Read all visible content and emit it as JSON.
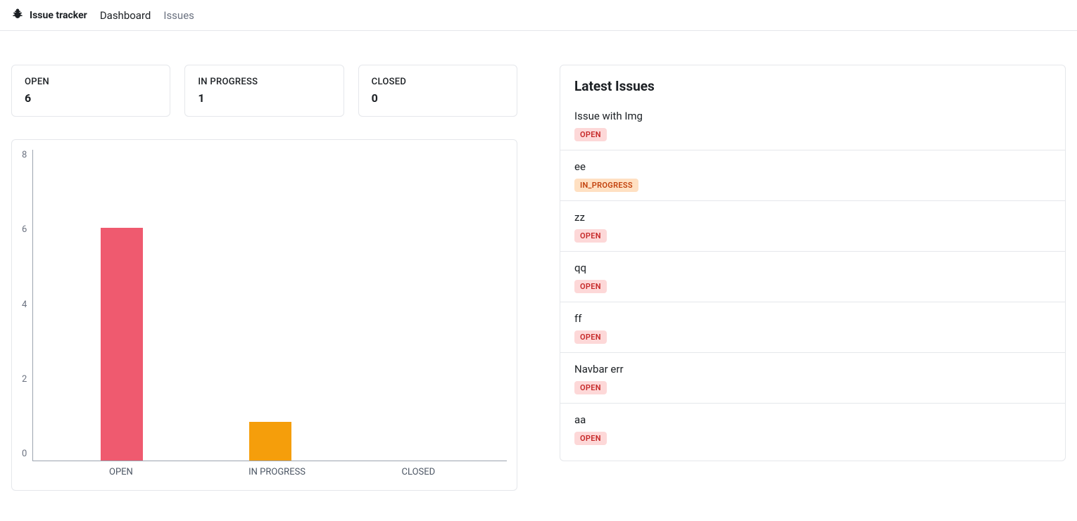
{
  "brand": {
    "title": "Issue tracker"
  },
  "nav": {
    "items": [
      {
        "label": "Dashboard",
        "active": true
      },
      {
        "label": "Issues",
        "active": false
      }
    ]
  },
  "stats": [
    {
      "label": "OPEN",
      "value": "6"
    },
    {
      "label": "IN PROGRESS",
      "value": "1"
    },
    {
      "label": "CLOSED",
      "value": "0"
    }
  ],
  "chart_data": {
    "type": "bar",
    "categories": [
      "OPEN",
      "IN PROGRESS",
      "CLOSED"
    ],
    "values": [
      6,
      1,
      0
    ],
    "title": "",
    "xlabel": "",
    "ylabel": "",
    "ylim": [
      0,
      8
    ],
    "yticks": [
      0,
      2,
      4,
      6,
      8
    ],
    "colors": [
      "#ef5a6f",
      "#f59e0b",
      "#22c55e"
    ]
  },
  "latest": {
    "heading": "Latest Issues",
    "items": [
      {
        "title": "Issue with Img",
        "status": "OPEN"
      },
      {
        "title": "ee",
        "status": "IN_PROGRESS"
      },
      {
        "title": "zz",
        "status": "OPEN"
      },
      {
        "title": "qq",
        "status": "OPEN"
      },
      {
        "title": "ff",
        "status": "OPEN"
      },
      {
        "title": "Navbar err",
        "status": "OPEN"
      },
      {
        "title": "aa",
        "status": "OPEN"
      }
    ]
  }
}
